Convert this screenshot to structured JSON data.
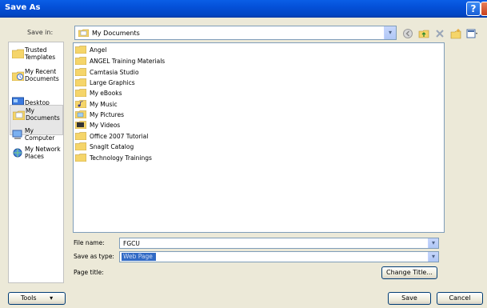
{
  "window": {
    "title": "Save As",
    "help_glyph": "?",
    "close_glyph": "x"
  },
  "save_in": {
    "label": "Save in:",
    "value": "My Documents",
    "dropdown_glyph": "▾"
  },
  "toolbar": {
    "icons": [
      "back-icon",
      "up-folder-icon",
      "delete-icon",
      "new-folder-icon",
      "views-icon"
    ]
  },
  "places": [
    {
      "label_lines": [
        "Trusted",
        "Templates"
      ],
      "icon": "folder-icon"
    },
    {
      "label_lines": [
        "My Recent",
        "Documents"
      ],
      "icon": "recent-documents-icon"
    },
    {
      "label_lines": [
        "Desktop"
      ],
      "icon": "desktop-icon"
    },
    {
      "label_lines": [
        "My",
        "Documents"
      ],
      "icon": "my-documents-icon",
      "active": true
    },
    {
      "label_lines": [
        "My",
        "Computer"
      ],
      "icon": "my-computer-icon"
    },
    {
      "label_lines": [
        "My Network",
        "Places"
      ],
      "icon": "network-places-icon"
    }
  ],
  "files": [
    {
      "name": "Angel",
      "icon": "folder-icon"
    },
    {
      "name": "ANGEL Training Materials",
      "icon": "folder-icon"
    },
    {
      "name": "Camtasia Studio",
      "icon": "folder-icon"
    },
    {
      "name": "Large Graphics",
      "icon": "folder-icon"
    },
    {
      "name": "My eBooks",
      "icon": "folder-icon"
    },
    {
      "name": "My Music",
      "icon": "music-folder-icon"
    },
    {
      "name": "My Pictures",
      "icon": "pictures-folder-icon"
    },
    {
      "name": "My Videos",
      "icon": "videos-folder-icon"
    },
    {
      "name": "Office 2007 Tutorial",
      "icon": "folder-icon"
    },
    {
      "name": "SnagIt Catalog",
      "icon": "folder-icon"
    },
    {
      "name": "Technology Trainings",
      "icon": "folder-icon"
    }
  ],
  "form": {
    "file_name_label": "File name:",
    "file_name_value": "FGCU",
    "save_as_type_label": "Save as type:",
    "save_as_type_value": "Web Page",
    "page_title_label": "Page title:",
    "change_title_button": "Change Title..."
  },
  "buttons": {
    "tools": "Tools",
    "tools_arrow": "▾",
    "save": "Save",
    "cancel": "Cancel"
  },
  "colors": {
    "titlebar": "#0450d8",
    "selection": "#316ac5",
    "folder": "#f5d56a"
  }
}
